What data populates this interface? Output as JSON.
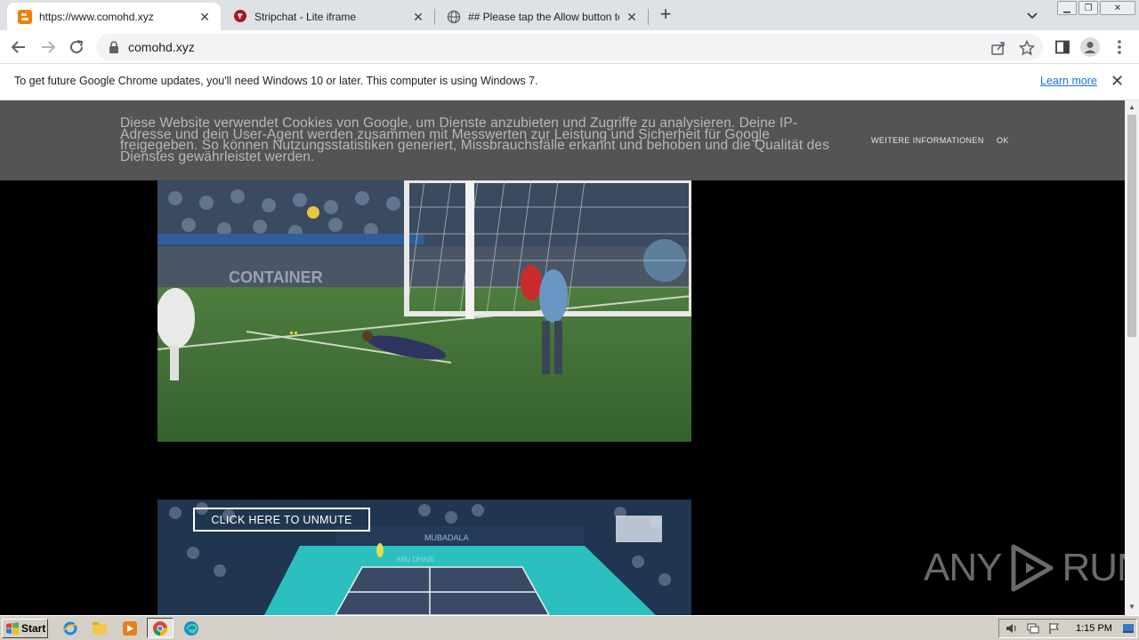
{
  "browser": {
    "tabs": [
      {
        "title": "https://www.comohd.xyz",
        "active": true,
        "icon": "blogger-icon"
      },
      {
        "title": "Stripchat - Lite iframe",
        "active": false,
        "icon": "stripchat-icon"
      },
      {
        "title": "## Please tap the Allow button to c",
        "active": false,
        "icon": "globe-icon"
      }
    ],
    "url": "comohd.xyz",
    "infobar": {
      "message": "To get future Google Chrome updates, you'll need Windows 10 or later. This computer is using Windows 7.",
      "learn_more": "Learn more"
    }
  },
  "page": {
    "cookie_banner": {
      "text": "Diese Website verwendet Cookies von Google, um Dienste anzubieten und Zugriffe zu analysieren. Deine IP-Adresse und dein User-Agent werden zusammen mit Messwerten zur Leistung und Sicherheit für Google freigegeben. So können Nutzungsstatistiken generiert, Missbrauchsfälle erkannt und behoben und die Qualität des Dienstes gewährleistet werden.",
      "more_info": "WEITERE INFORMATIONEN",
      "ok": "OK"
    },
    "video2": {
      "unmute_label": "CLICK HERE TO UNMUTE",
      "arena_text": "MUBADALA",
      "court_text": "ABU DHABI"
    },
    "watermark": {
      "left": "ANY",
      "right": "RUN"
    }
  },
  "taskbar": {
    "start_label": "Start",
    "clock": "1:15 PM",
    "apps": [
      "ie-icon",
      "explorer-icon",
      "media-player-icon",
      "chrome-icon",
      "edge-icon"
    ]
  },
  "colors": {
    "tabstrip": "#dee1e6",
    "omnibox": "#f1f3f4",
    "link": "#1a73e8",
    "cookie_bg": "#5a5a5a",
    "pitch": "#3d6b35",
    "court": "#2bbfc0",
    "taskbar": "#d4d0c8"
  }
}
